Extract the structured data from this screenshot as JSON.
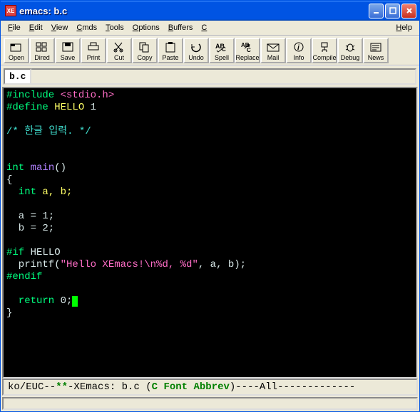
{
  "title": "emacs: b.c",
  "titlebar_icon": "XE",
  "menus": [
    "File",
    "Edit",
    "View",
    "Cmds",
    "Tools",
    "Options",
    "Buffers",
    "C"
  ],
  "menu_help": "Help",
  "toolbar": [
    {
      "name": "open",
      "label": "Open"
    },
    {
      "name": "dired",
      "label": "Dired"
    },
    {
      "name": "save",
      "label": "Save"
    },
    {
      "name": "print",
      "label": "Print"
    },
    {
      "name": "cut",
      "label": "Cut"
    },
    {
      "name": "copy",
      "label": "Copy"
    },
    {
      "name": "paste",
      "label": "Paste"
    },
    {
      "name": "undo",
      "label": "Undo"
    },
    {
      "name": "spell",
      "label": "Spell"
    },
    {
      "name": "replace",
      "label": "Replace"
    },
    {
      "name": "mail",
      "label": "Mail"
    },
    {
      "name": "info",
      "label": "Info"
    },
    {
      "name": "compile",
      "label": "Compile"
    },
    {
      "name": "debug",
      "label": "Debug"
    },
    {
      "name": "news",
      "label": "News"
    }
  ],
  "buffer_name": "b.c",
  "code": {
    "l1_inc": "#include ",
    "l1_hdr": "<stdio.h>",
    "l2_def": "#define ",
    "l2_name": "HELLO",
    "l2_val": " 1",
    "l3_comment": "/* 한글 입력. */",
    "l4_type": "int ",
    "l4_fn": "main",
    "l4_paren": "()",
    "l5": "{",
    "l6_kw": "  int ",
    "l6_v": "a, b;",
    "l7": "  a = 1;",
    "l8": "  b = 2;",
    "l9_if": "#if ",
    "l9_name": "HELLO",
    "l10a": "  printf(",
    "l10b": "\"Hello XEmacs!\\n%d, %d\"",
    "l10c": ", a, b);",
    "l11": "#endif",
    "l12_kw": "  return ",
    "l12_v": "0;",
    "l13": "}"
  },
  "modeline": {
    "a": "ko/EUC--",
    "b": "**",
    "c": "-XEmacs: b.c       (",
    "d": "C Font Abbrev",
    "e": ")----All-------------"
  }
}
